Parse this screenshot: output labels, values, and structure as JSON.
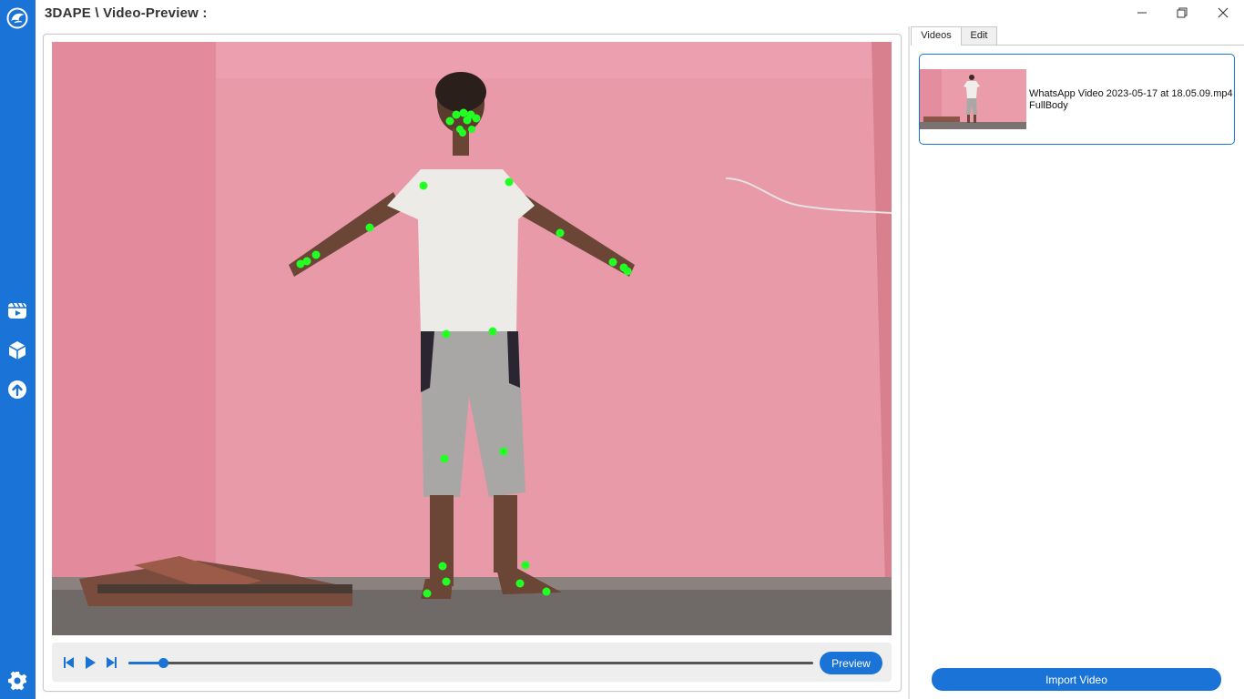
{
  "app": {
    "title": "3DAPE \\ Video-Preview :"
  },
  "window_controls": [
    "minimize-icon",
    "restore-icon",
    "close-icon"
  ],
  "sidebar": {
    "icons": [
      "app-logo-icon",
      "video-reel-icon",
      "cube-icon",
      "upload-icon",
      "settings-gear-icon"
    ]
  },
  "player": {
    "controls": [
      "step-back-icon",
      "play-icon",
      "step-forward-icon"
    ],
    "progress": 0.05,
    "preview_label": "Preview"
  },
  "right_panel": {
    "tabs": [
      {
        "label": "Videos",
        "active": true
      },
      {
        "label": "Edit",
        "active": false
      }
    ],
    "videos": [
      {
        "name": "WhatsApp Video 2023-05-17 at 18.05.09.mp4",
        "type": "FullBody"
      }
    ],
    "import_label": "Import Video"
  },
  "colors": {
    "accent": "#1a73d6",
    "keypoint": "#22ff22",
    "wall": "#e89aa8"
  }
}
